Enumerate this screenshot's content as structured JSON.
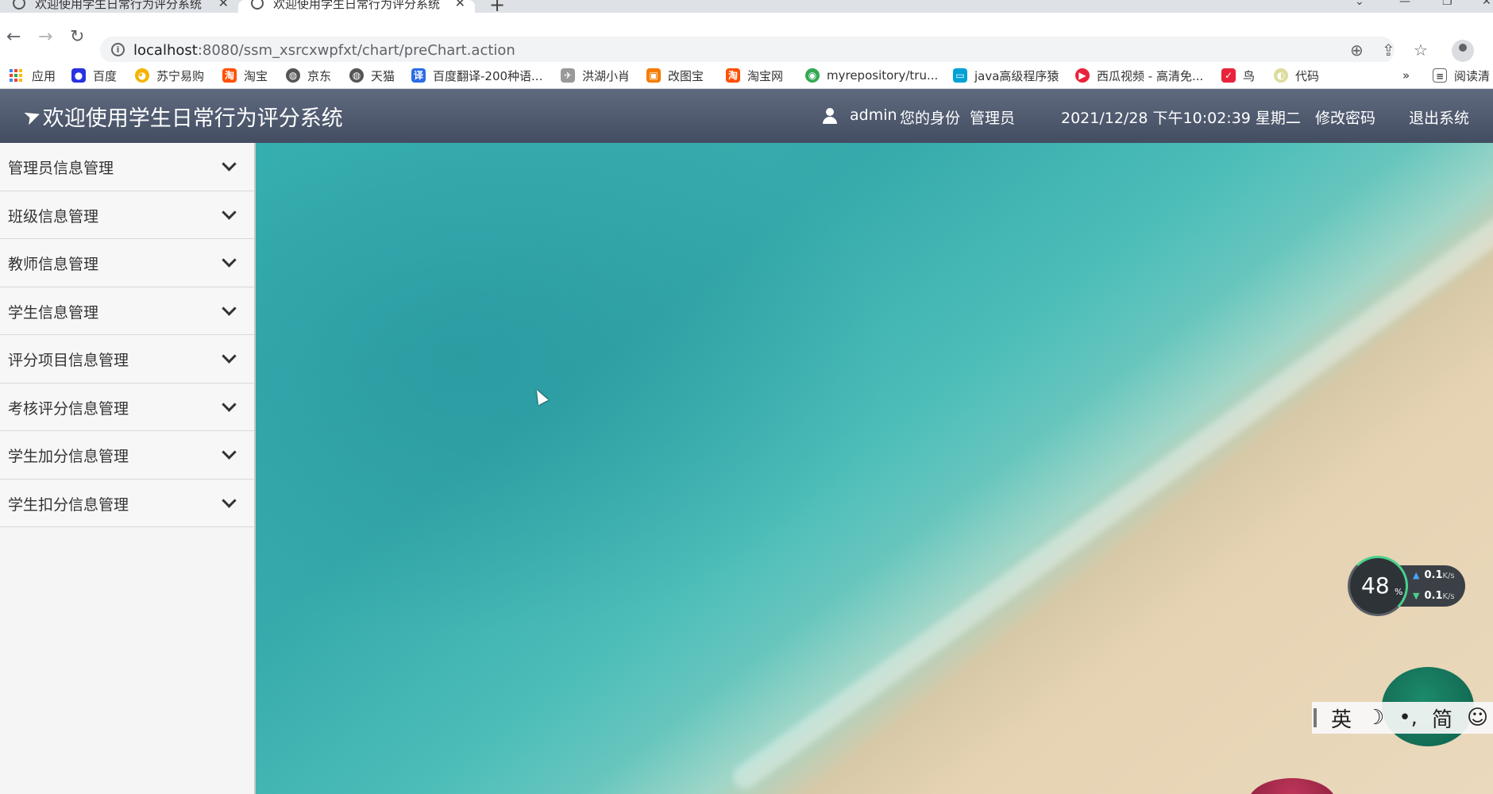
{
  "browser": {
    "tabs": [
      {
        "title": "欢迎使用学生日常行为评分系统",
        "active": false
      },
      {
        "title": "欢迎使用学生日常行为评分系统",
        "active": true
      }
    ],
    "new_tab": "+",
    "url_host": "localhost",
    "url_path": ":8080/ssm_xsrcxwpfxt/chart/preChart.action",
    "bookmarks": [
      {
        "label": "应用",
        "icon": "apps-grid-icon"
      },
      {
        "label": "百度",
        "icon": "baidu-paw-icon",
        "color": "#2932e1"
      },
      {
        "label": "苏宁易购",
        "icon": "suning-icon",
        "color": "#f6b300"
      },
      {
        "label": "淘宝",
        "icon": "taobao-icon",
        "color": "#ff5000"
      },
      {
        "label": "京东",
        "icon": "globe-icon",
        "color": "#555555"
      },
      {
        "label": "天猫",
        "icon": "globe-icon",
        "color": "#555555"
      },
      {
        "label": "百度翻译-200种语...",
        "icon": "baidu-translate-icon",
        "color": "#2b6de5"
      },
      {
        "label": "洪湖小肖",
        "icon": "bird-icon",
        "color": "#888888"
      },
      {
        "label": "改图宝",
        "icon": "gaitubao-icon",
        "color": "#f57c00"
      },
      {
        "label": "淘宝网",
        "icon": "taobao-icon",
        "color": "#ff5000"
      },
      {
        "label": "myrepository/tru...",
        "icon": "chrome-icon",
        "color": "#34a853"
      },
      {
        "label": "java高级程序猿",
        "icon": "bilibili-icon",
        "color": "#00a1d6"
      },
      {
        "label": "西瓜视频 - 高清免...",
        "icon": "xigua-icon",
        "color": "#e8233b"
      },
      {
        "label": "鸟",
        "icon": "bird-red-icon",
        "color": "#e8233b"
      },
      {
        "label": "代码",
        "icon": "code-icon",
        "color": "#c9c94a"
      }
    ],
    "bookmarks_more": "»",
    "reading_list": "阅读清"
  },
  "header": {
    "title": "欢迎使用学生日常行为评分系统",
    "username": "admin",
    "role_label": "您的身份",
    "role_value": "管理员",
    "datetime": "2021/12/28 下午10:02:39 星期二",
    "change_password": "修改密码",
    "logout": "退出系统",
    "bg_top": "#5f6a80",
    "bg_bottom": "#434d61"
  },
  "sidebar": {
    "items": [
      {
        "label": "管理员信息管理"
      },
      {
        "label": "班级信息管理"
      },
      {
        "label": "教师信息管理"
      },
      {
        "label": "学生信息管理"
      },
      {
        "label": "评分项目信息管理"
      },
      {
        "label": "考核评分信息管理"
      },
      {
        "label": "学生加分信息管理"
      },
      {
        "label": "学生扣分信息管理"
      }
    ]
  },
  "net_monitor": {
    "percent": "48",
    "percent_unit": "%",
    "upload": "0.1",
    "download": "0.1",
    "rate_unit": "K/s"
  },
  "ime": {
    "lang": "英",
    "moon": "☽",
    "punct": "•,",
    "mode": "简",
    "emoji": "☺"
  }
}
